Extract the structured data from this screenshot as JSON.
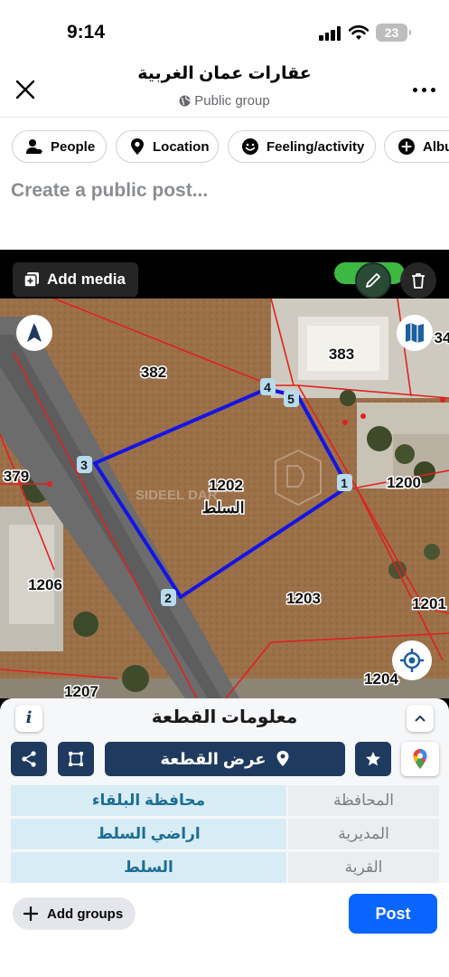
{
  "status_bar": {
    "time": "9:14",
    "battery": "23"
  },
  "header": {
    "title": "عقارات عمان الغربية",
    "subtitle": "Public group"
  },
  "actions": [
    {
      "label": "People",
      "icon": "person-tag-icon"
    },
    {
      "label": "Location",
      "icon": "location-pin-icon"
    },
    {
      "label": "Feeling/activity",
      "icon": "smiley-icon"
    },
    {
      "label": "Album",
      "icon": "add-circle-icon"
    }
  ],
  "composer": {
    "placeholder": "Create a public post..."
  },
  "media": {
    "add_media_label": "Add media",
    "map": {
      "parcels": [
        "382",
        "383",
        "1202",
        "379",
        "1200",
        "1206",
        "1203",
        "1201",
        "1207",
        "1204",
        "34"
      ],
      "parcel_village": "السلط",
      "vertex_labels": [
        "1",
        "2",
        "3",
        "4",
        "5"
      ],
      "watermark": "SIDEEL DAR",
      "colors": {
        "boundary": "#e02020",
        "selected_parcel": "#1414e6"
      }
    },
    "panel": {
      "title": "معلومات القطعة",
      "show_parcel_label": "عرض القطعة",
      "rows": [
        {
          "key": "المحافظة",
          "value": "محافظة البلقاء"
        },
        {
          "key": "المديرية",
          "value": "اراضي السلط"
        },
        {
          "key": "القرية",
          "value": "السلط"
        }
      ]
    }
  },
  "footer": {
    "add_groups_label": "Add groups",
    "post_label": "Post"
  },
  "colors": {
    "primary": "#0866ff",
    "panel_navy": "#1e3a5f",
    "value_text": "#1c6d94"
  }
}
